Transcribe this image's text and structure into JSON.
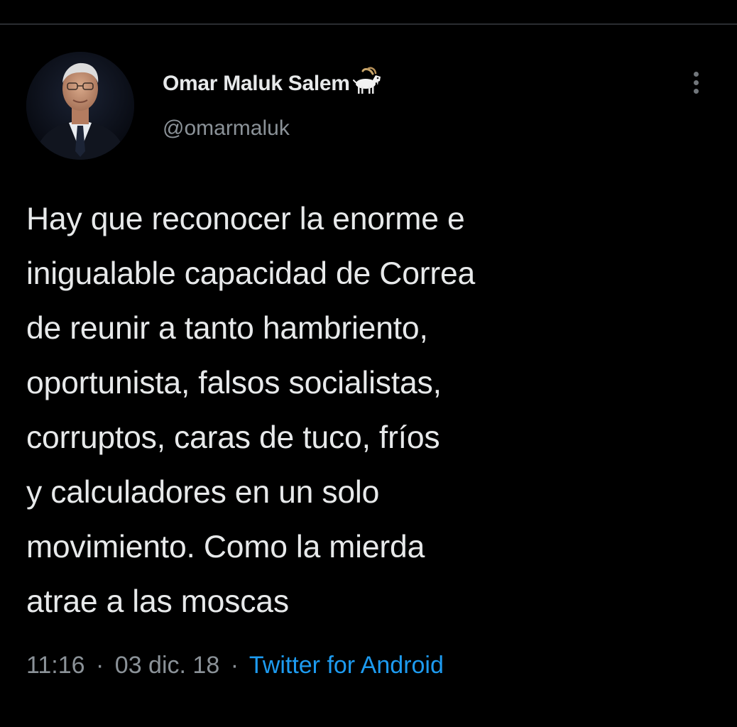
{
  "tweet": {
    "author": {
      "display_name": "Omar Maluk Salem",
      "name_emoji": "goat-icon",
      "handle": "@omarmaluk",
      "avatar": "avatar-photo"
    },
    "text": "Hay que reconocer la enorme e\ninigualable  capacidad de Correa\nde reunir a tanto hambriento,\noportunista, falsos socialistas,\ncorruptos, caras de tuco, fríos\ny calculadores en un solo\nmovimiento.  Como la mierda\natrae a las moscas",
    "time": "11:16",
    "separator": "·",
    "date": "03 dic. 18",
    "source": "Twitter for Android",
    "more_icon": "more-vertical-icon"
  },
  "colors": {
    "background": "#000000",
    "text_primary": "#e7e9ea",
    "text_secondary": "#8b9298",
    "link": "#1d9bf0"
  }
}
